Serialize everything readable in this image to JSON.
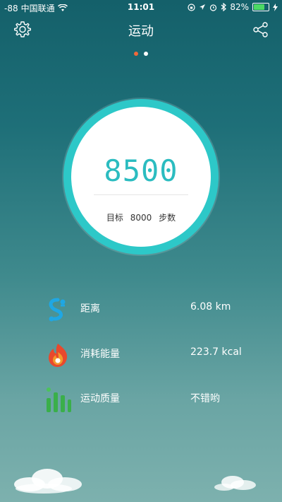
{
  "status": {
    "signal": "-88",
    "carrier": "中国联通",
    "time": "11:01",
    "battery": "82%",
    "battery_level": 0.82
  },
  "nav": {
    "title": "运动"
  },
  "pager": {
    "active_color": "#f0683a",
    "inactive_color": "#ffffff"
  },
  "steps": {
    "value": "8500",
    "goal_prefix": "目标",
    "goal_value": "8000",
    "goal_unit": "步数"
  },
  "stats": [
    {
      "icon": "distance-icon",
      "label": "距离",
      "value": "6.08 km"
    },
    {
      "icon": "calorie-flame-icon",
      "label": "消耗能量",
      "value": "223.7 kcal"
    },
    {
      "icon": "quality-bars-icon",
      "label": "运动质量",
      "value": "不错哟"
    }
  ],
  "colors": {
    "ring": "#2dc8c8",
    "steps_text": "#2bbcc0"
  }
}
